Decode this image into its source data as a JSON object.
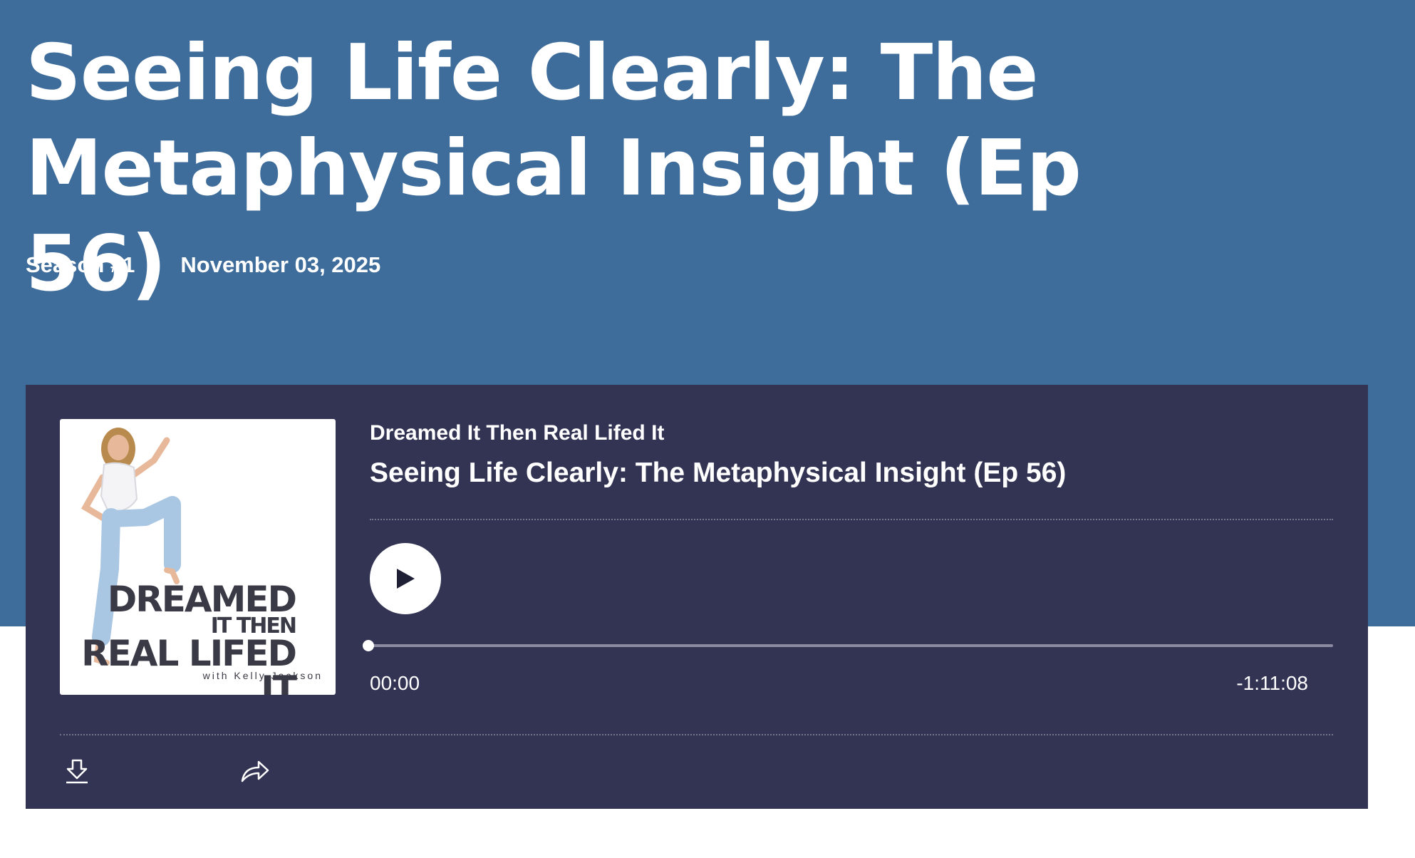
{
  "page": {
    "title": "Seeing Life Clearly: The Metaphysical Insight (Ep 56)",
    "season": "Season #1",
    "date": "November 03, 2025"
  },
  "player": {
    "show_name": "Dreamed It Then Real Lifed It",
    "episode_title": "Seeing Life Clearly: The Metaphysical Insight (Ep 56)",
    "cover": {
      "title_line1": "DREAMED",
      "title_line2": "IT THEN",
      "title_line3": "REAL LIFED IT",
      "credit": "with Kelly Jackson"
    },
    "current_time": "00:00",
    "remaining_time": "-1:11:08",
    "progress": 0,
    "controls": {
      "play_icon": "play-icon",
      "download_icon": "download-icon",
      "share_icon": "share-icon"
    }
  },
  "colors": {
    "hero_background": "#3e6d9c",
    "player_background": "#333454",
    "text": "#ffffff"
  }
}
